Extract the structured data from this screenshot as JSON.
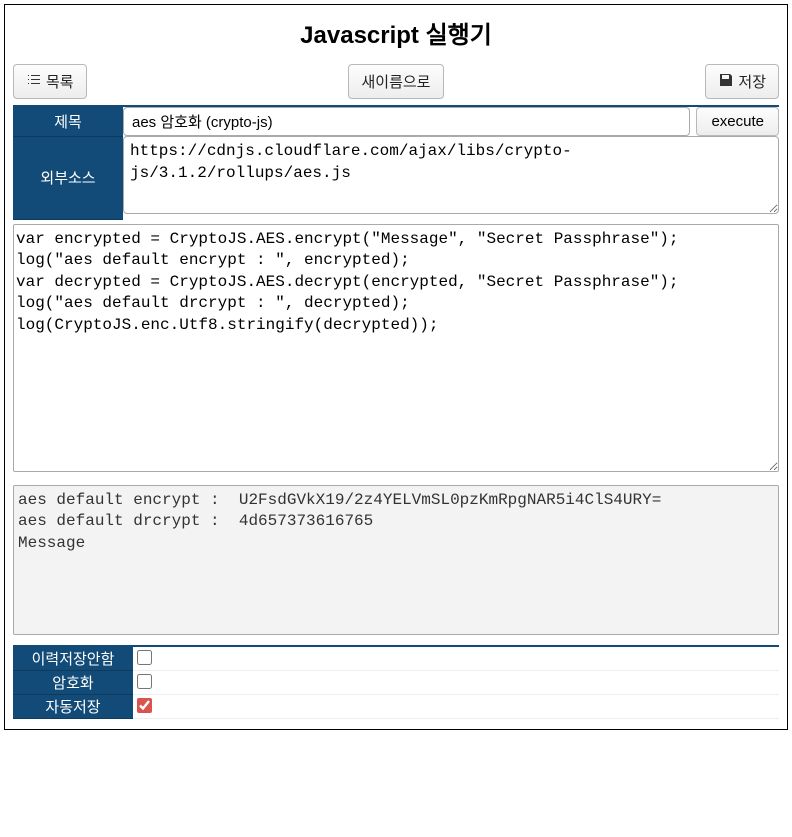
{
  "page": {
    "title": "Javascript 실행기"
  },
  "toolbar": {
    "list_label": "목록",
    "saveas_label": "새이름으로",
    "save_label": "저장"
  },
  "form": {
    "title_label": "제목",
    "title_value": "aes 암호화 (crypto-js)",
    "execute_label": "execute",
    "extsrc_label": "외부소스",
    "extsrc_value": "https://cdnjs.cloudflare.com/ajax/libs/crypto-js/3.1.2/rollups/aes.js"
  },
  "code": "var encrypted = CryptoJS.AES.encrypt(\"Message\", \"Secret Passphrase\");\nlog(\"aes default encrypt : \", encrypted);\nvar decrypted = CryptoJS.AES.decrypt(encrypted, \"Secret Passphrase\");\nlog(\"aes default drcrypt : \", decrypted);\nlog(CryptoJS.enc.Utf8.stringify(decrypted));",
  "output": "aes default encrypt :  U2FsdGVkX19/2z4YELVmSL0pzKmRpgNAR5i4ClS4URY=\naes default drcrypt :  4d657373616765\nMessage",
  "options": {
    "no_history_label": "이력저장안함",
    "no_history_checked": false,
    "encrypt_label": "암호화",
    "encrypt_checked": false,
    "autosave_label": "자동저장",
    "autosave_checked": true
  }
}
